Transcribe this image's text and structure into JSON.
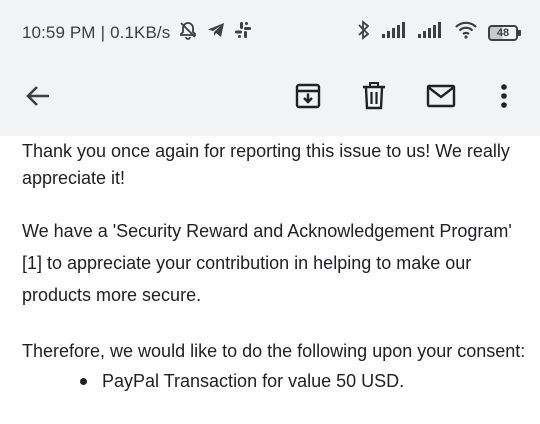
{
  "status_bar": {
    "time": "10:59 PM",
    "separator": "|",
    "network_speed": "0.1KB/s",
    "left_icons": [
      "mute-alarm-icon",
      "telegram-icon",
      "slack-icon"
    ],
    "right_icons": [
      "bluetooth-icon",
      "signal-icon",
      "signal-icon",
      "wifi-icon"
    ],
    "battery_level": "48"
  },
  "toolbar": {
    "back_icon": "arrow-left-icon",
    "archive_icon": "archive-icon",
    "delete_icon": "trash-icon",
    "mail_icon": "mail-icon",
    "more_icon": "more-vertical-icon"
  },
  "email": {
    "paragraph_1": "Thank you once again for reporting this issue to us! We really appreciate it!",
    "paragraph_2": "We have a 'Security Reward and Acknowledgement Program' [1] to appreciate your contribution in helping to make our products more secure.",
    "paragraph_3": "Therefore, we would like to do the following upon your consent:",
    "bullets": [
      "PayPal Transaction for value 50 USD."
    ]
  }
}
